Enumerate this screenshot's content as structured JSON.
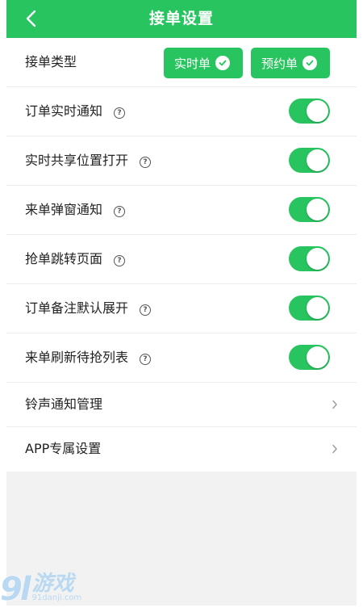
{
  "header": {
    "title": "接单设置",
    "back_icon": "chevron-left-icon"
  },
  "order_type": {
    "label": "接单类型",
    "options": [
      {
        "label": "实时单",
        "checked": true
      },
      {
        "label": "预约单",
        "checked": true
      }
    ]
  },
  "toggles": [
    {
      "label": "订单实时通知",
      "on": true
    },
    {
      "label": "实时共享位置打开",
      "on": true
    },
    {
      "label": "来单弹窗通知",
      "on": true
    },
    {
      "label": "抢单跳转页面",
      "on": true
    },
    {
      "label": "订单备注默认展开",
      "on": true
    },
    {
      "label": "来单刷新待抢列表",
      "on": true
    }
  ],
  "links": [
    {
      "label": "铃声通知管理"
    },
    {
      "label": "APP专属设置"
    }
  ],
  "help_glyph": "?",
  "colors": {
    "accent": "#27c45f",
    "background": "#f2f2f2"
  },
  "watermark": {
    "logo": "9l",
    "brand": "游戏",
    "domain": "91danji.com"
  }
}
